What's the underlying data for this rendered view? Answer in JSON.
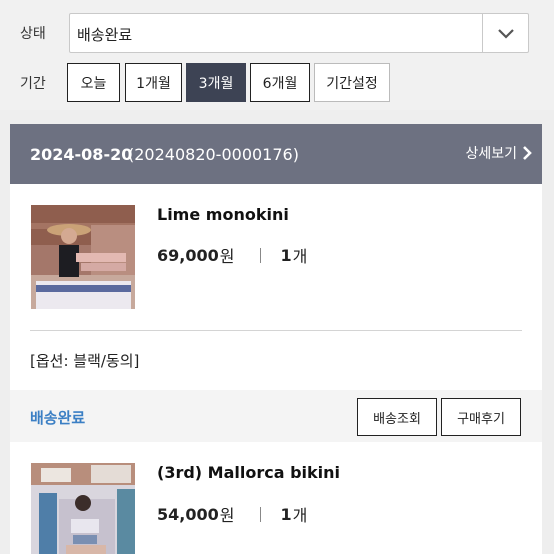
{
  "filter": {
    "status_label": "상태",
    "status_value": "배송완료",
    "period_label": "기간",
    "period_buttons": [
      {
        "label": "오늘"
      },
      {
        "label": "1개월"
      },
      {
        "label": "3개월"
      },
      {
        "label": "6개월"
      },
      {
        "label": "기간설정"
      }
    ],
    "active_period": "3개월"
  },
  "order": {
    "date": "2024-08-20",
    "number": "(20240820-0000176)",
    "detail_label": "상세보기",
    "status": "배송완료",
    "track_label": "배송조회",
    "review_label": "구매후기",
    "items": [
      {
        "name": "Lime monokini",
        "price": "69,000",
        "currency": "원",
        "qty": "1",
        "qty_unit": "개",
        "option": "[옵션: 블랙/동의]"
      },
      {
        "name": "(3rd) Mallorca bikini",
        "price": "54,000",
        "currency": "원",
        "qty": "1",
        "qty_unit": "개"
      }
    ]
  },
  "colors": {
    "header_bg": "#6d7181",
    "active_button": "#3d4354",
    "status_blue": "#3b7fc4"
  },
  "icons": {
    "dropdown": "chevron-down-icon",
    "detail": "chevron-right-icon"
  }
}
